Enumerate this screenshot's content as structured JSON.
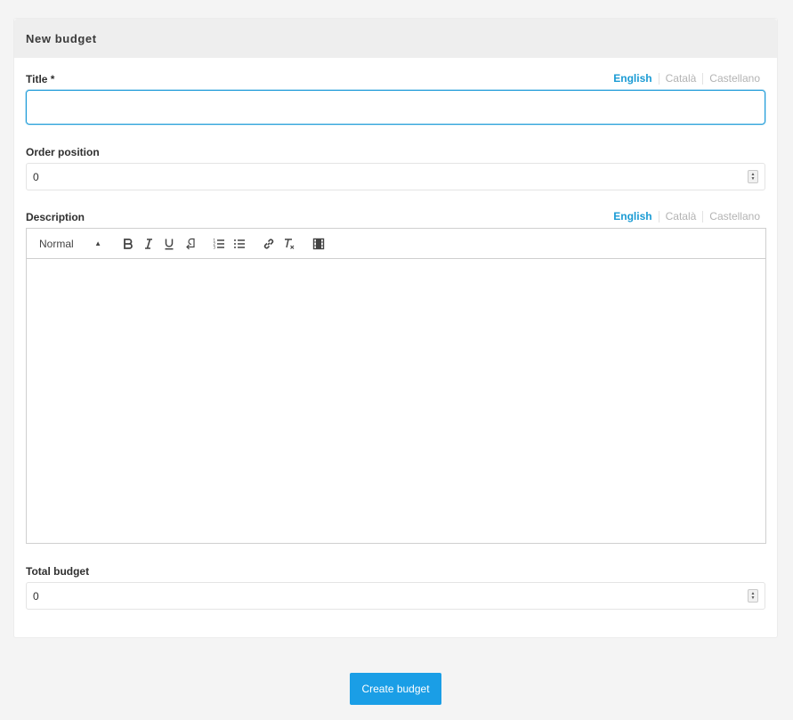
{
  "form": {
    "header_title": "New budget",
    "title": {
      "label": "Title *",
      "value": "",
      "languages": [
        "English",
        "Català",
        "Castellano"
      ],
      "active_language": "English"
    },
    "order_position": {
      "label": "Order position",
      "value": "0"
    },
    "description": {
      "label": "Description",
      "languages": [
        "English",
        "Català",
        "Castellano"
      ],
      "active_language": "English",
      "toolbar": {
        "format_select": "Normal",
        "buttons": [
          "bold-icon",
          "italic-icon",
          "underline-icon",
          "paragraph-icon",
          "ordered-list-icon",
          "bullet-list-icon",
          "link-icon",
          "clear-format-icon",
          "video-icon"
        ]
      },
      "content": ""
    },
    "total_budget": {
      "label": "Total budget",
      "value": "0"
    },
    "submit_label": "Create budget"
  },
  "colors": {
    "accent": "#1a9bd4",
    "button": "#1a9ee6",
    "header_bg": "#eeeeee",
    "page_bg": "#f4f4f4"
  }
}
